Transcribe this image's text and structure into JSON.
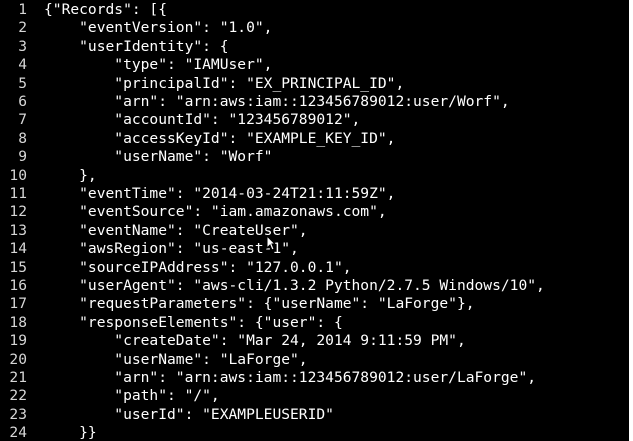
{
  "editor": {
    "language": "JSON",
    "cursor_line": 14,
    "colors": {
      "background": "#000000",
      "text": "#ffffff",
      "line_numbers": "#d6d6d6",
      "braces": "#a9a9a9"
    }
  },
  "lines": [
    {
      "number": "1",
      "text": "{\"Records\": [{"
    },
    {
      "number": "2",
      "text": "    \"eventVersion\": \"1.0\","
    },
    {
      "number": "3",
      "text": "    \"userIdentity\": {"
    },
    {
      "number": "4",
      "text": "        \"type\": \"IAMUser\","
    },
    {
      "number": "5",
      "text": "        \"principalId\": \"EX_PRINCIPAL_ID\","
    },
    {
      "number": "6",
      "text": "        \"arn\": \"arn:aws:iam::123456789012:user/Worf\","
    },
    {
      "number": "7",
      "text": "        \"accountId\": \"123456789012\","
    },
    {
      "number": "8",
      "text": "        \"accessKeyId\": \"EXAMPLE_KEY_ID\","
    },
    {
      "number": "9",
      "text": "        \"userName\": \"Worf\""
    },
    {
      "number": "10",
      "text": "    },"
    },
    {
      "number": "11",
      "text": "    \"eventTime\": \"2014-03-24T21:11:59Z\","
    },
    {
      "number": "12",
      "text": "    \"eventSource\": \"iam.amazonaws.com\","
    },
    {
      "number": "13",
      "text": "    \"eventName\": \"CreateUser\","
    },
    {
      "number": "14",
      "text": "    \"awsRegion\": \"us-east-1\","
    },
    {
      "number": "15",
      "text": "    \"sourceIPAddress\": \"127.0.0.1\","
    },
    {
      "number": "16",
      "text": "    \"userAgent\": \"aws-cli/1.3.2 Python/2.7.5 Windows/10\","
    },
    {
      "number": "17",
      "text": "    \"requestParameters\": {\"userName\": \"LaForge\"},"
    },
    {
      "number": "18",
      "text": "    \"responseElements\": {\"user\": {"
    },
    {
      "number": "19",
      "text": "        \"createDate\": \"Mar 24, 2014 9:11:59 PM\","
    },
    {
      "number": "20",
      "text": "        \"userName\": \"LaForge\","
    },
    {
      "number": "21",
      "text": "        \"arn\": \"arn:aws:iam::123456789012:user/LaForge\","
    },
    {
      "number": "22",
      "text": "        \"path\": \"/\","
    },
    {
      "number": "23",
      "text": "        \"userId\": \"EXAMPLEUSERID\""
    },
    {
      "number": "24",
      "text": "    }}"
    }
  ]
}
